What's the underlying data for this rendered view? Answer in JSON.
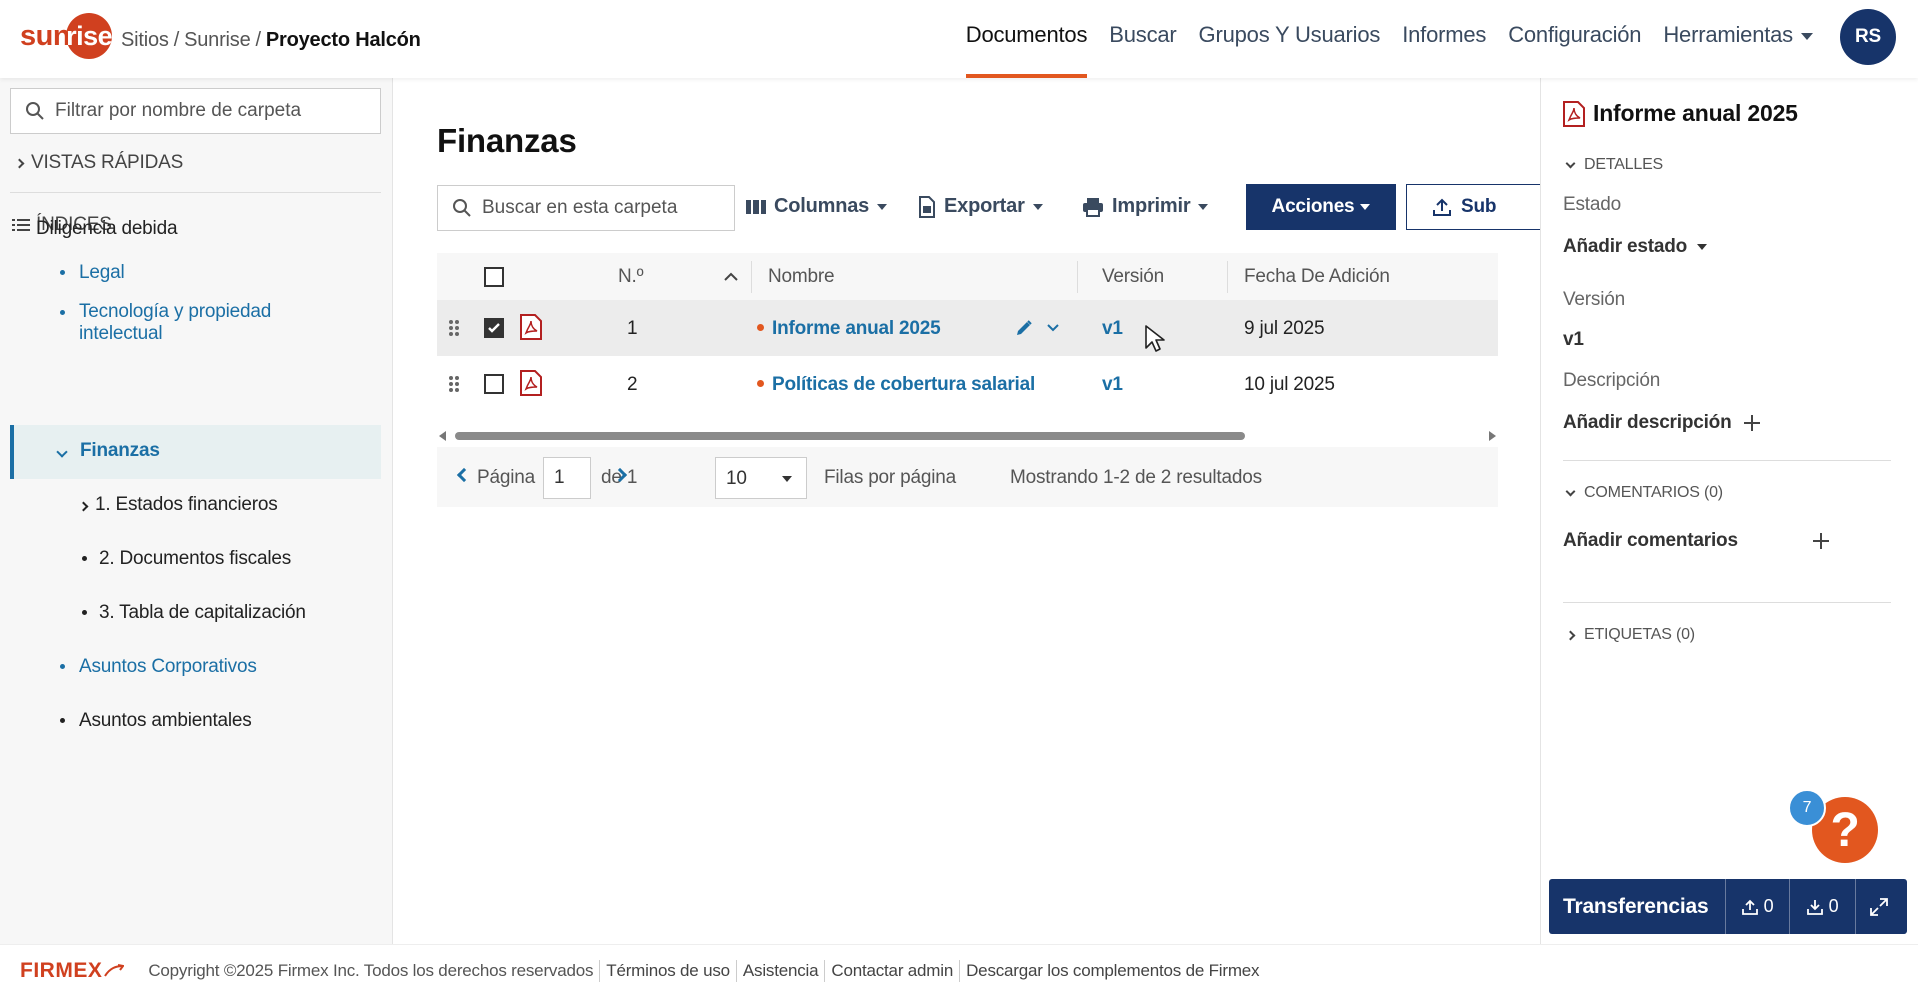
{
  "header": {
    "logo_text": "sun",
    "logo_text_ring": "rise",
    "breadcrumb": [
      "Sitios",
      "Sunrise",
      "Proyecto Halcón"
    ],
    "breadcrumb_sep": "/",
    "nav": [
      "Documentos",
      "Buscar",
      "Grupos Y Usuarios",
      "Informes",
      "Configuración",
      "Herramientas"
    ],
    "active_nav": "Documentos",
    "avatar": "RS"
  },
  "sidebar": {
    "filter_placeholder": "Filtrar por nombre de carpeta",
    "quick_views": "VISTAS RÁPIDAS",
    "indices": "ÍNDICES",
    "tree": {
      "root": "Diligencia debida",
      "legal": "Legal",
      "tech": "Tecnología y propiedad intelectual",
      "finance": "Finanzas",
      "statements": "1. Estados financieros",
      "fiscal": "2. Documentos fiscales",
      "cap_table": "3. Tabla de capitalización",
      "corporate": "Asuntos Corporativos",
      "environmental": "Asuntos ambientales"
    }
  },
  "main": {
    "title": "Finanzas",
    "search_placeholder": "Buscar en esta carpeta",
    "toolbar": {
      "columns": "Columnas",
      "export": "Exportar",
      "print": "Imprimir",
      "actions": "Acciones",
      "upload": "Sub"
    },
    "table": {
      "headers": {
        "num": "N.º",
        "name": "Nombre",
        "version": "Versión",
        "date": "Fecha De Adición"
      },
      "rows": [
        {
          "num": "1",
          "name": "Informe anual 2025",
          "version": "v1",
          "date": "9 jul 2025",
          "checked": true
        },
        {
          "num": "2",
          "name": "Políticas de cobertura salarial",
          "version": "v1",
          "date": "10 jul 2025",
          "checked": false
        }
      ]
    },
    "pager": {
      "page_label": "Página",
      "page_value": "1",
      "of_label": "de 1",
      "rows_value": "10",
      "rows_label": "Filas por página",
      "showing": "Mostrando 1-2 de 2 resultados"
    }
  },
  "details_panel": {
    "title": "Informe anual 2025",
    "details_section": "DETALLES",
    "status_label": "Estado",
    "status_value": "Añadir estado",
    "version_label": "Versión",
    "version_value": "v1",
    "description_label": "Descripción",
    "description_value": "Añadir descripción",
    "comments_section": "COMENTARIOS (0)",
    "add_comments": "Añadir comentarios",
    "tags_section": "ETIQUETAS (0)"
  },
  "help": {
    "badge": "7",
    "icon": "?"
  },
  "transfers": {
    "label": "Transferencias",
    "uploads": "0",
    "downloads": "0"
  },
  "footer": {
    "brand": "FIRMEX",
    "copyright": "Copyright ©2025 Firmex Inc. Todos los derechos reservados",
    "links": [
      "Términos de uso",
      "Asistencia",
      "Contactar admin",
      "Descargar los complementos de Firmex"
    ]
  },
  "colors": {
    "navy": "#17346a",
    "accent": "#e2571f",
    "link": "#1b6fa5"
  }
}
